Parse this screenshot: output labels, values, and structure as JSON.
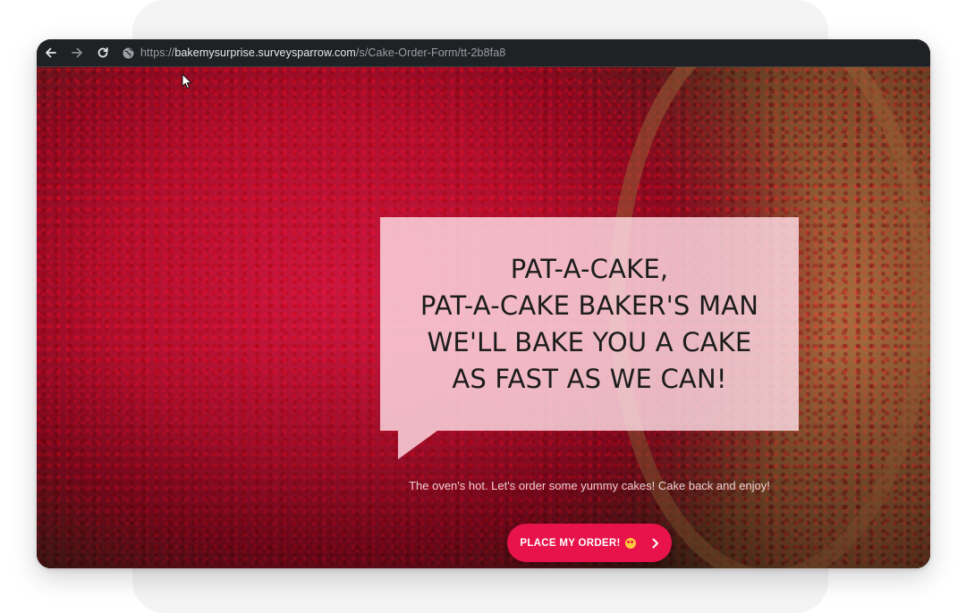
{
  "browser": {
    "url_scheme": "https://",
    "url_host": "bakemysurprise.surveysparrow.com",
    "url_path": "/s/Cake-Order-Form/tt-2b8fa8",
    "icons": [
      "back-icon",
      "forward-icon",
      "reload-icon",
      "globe-icon"
    ]
  },
  "hero": {
    "headline_lines": [
      "PAT-A-CAKE,",
      "PAT-A-CAKE BAKER'S MAN",
      "WE'LL BAKE YOU A CAKE",
      "AS FAST AS WE CAN!"
    ],
    "subtext": "The oven's hot. Let's order some yummy cakes! Cake back and enjoy!",
    "cta_label": "PLACE MY ORDER!",
    "cta_emoji": "heart-eyes-emoji-icon",
    "cta_icon": "chevron-right-icon"
  },
  "colors": {
    "accent": "#e8134a",
    "bubble": "#ffdee6",
    "toolbar": "#202124"
  }
}
